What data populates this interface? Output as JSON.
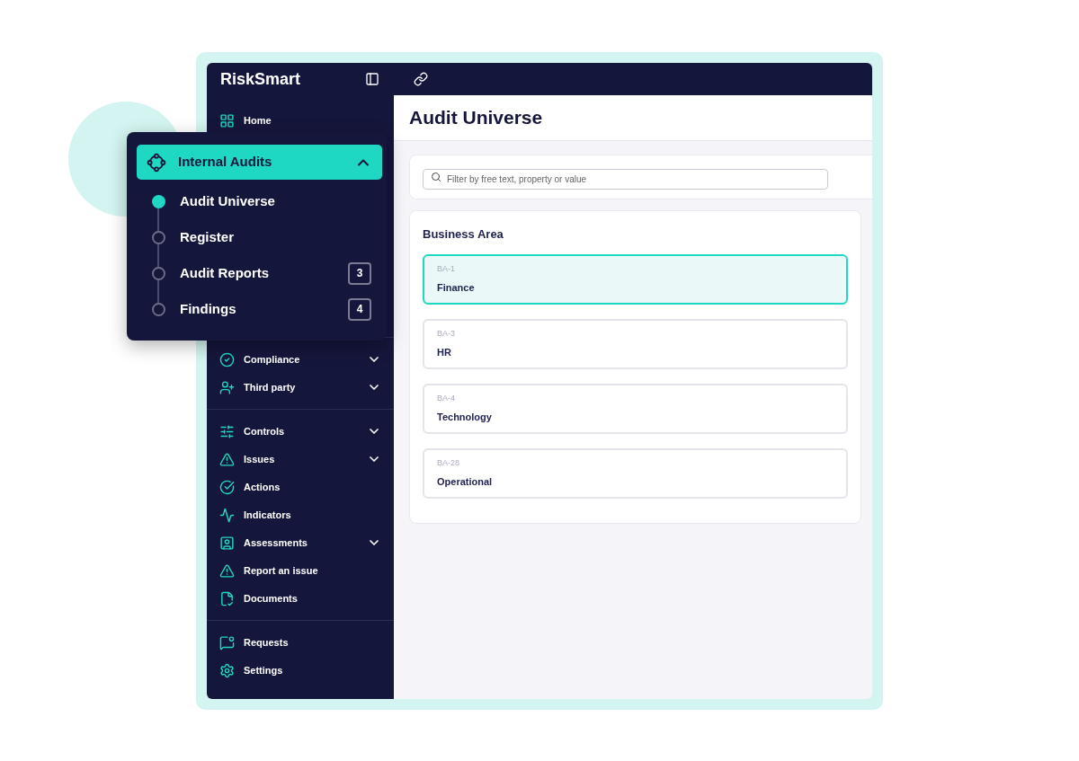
{
  "app": {
    "name": "RiskSmart"
  },
  "sidebar": {
    "groups": [
      [
        {
          "label": "Home",
          "has_submenu": false
        }
      ],
      [
        {
          "label": "Compliance",
          "has_submenu": true
        },
        {
          "label": "Third party",
          "has_submenu": true
        }
      ],
      [
        {
          "label": "Controls",
          "has_submenu": true
        },
        {
          "label": "Issues",
          "has_submenu": true
        },
        {
          "label": "Actions",
          "has_submenu": false
        },
        {
          "label": "Indicators",
          "has_submenu": false
        },
        {
          "label": "Assessments",
          "has_submenu": true
        },
        {
          "label": "Report an issue",
          "has_submenu": false
        },
        {
          "label": "Documents",
          "has_submenu": false
        }
      ],
      [
        {
          "label": "Requests",
          "has_submenu": false
        },
        {
          "label": "Settings",
          "has_submenu": false
        }
      ]
    ]
  },
  "popup": {
    "title": "Internal Audits",
    "expanded": true,
    "items": [
      {
        "label": "Audit Universe",
        "selected": true
      },
      {
        "label": "Register",
        "selected": false
      },
      {
        "label": "Audit Reports",
        "selected": false,
        "badge": "3"
      },
      {
        "label": "Findings",
        "selected": false,
        "badge": "4"
      }
    ]
  },
  "page": {
    "title": "Audit Universe",
    "search": {
      "placeholder": "Filter by free text, property or value"
    },
    "section": "Business Area",
    "cards": [
      {
        "code": "BA-1",
        "name": "Finance",
        "selected": true
      },
      {
        "code": "BA-3",
        "name": "HR",
        "selected": false
      },
      {
        "code": "BA-4",
        "name": "Technology",
        "selected": false
      },
      {
        "code": "BA-28",
        "name": "Operational",
        "selected": false
      }
    ]
  }
}
